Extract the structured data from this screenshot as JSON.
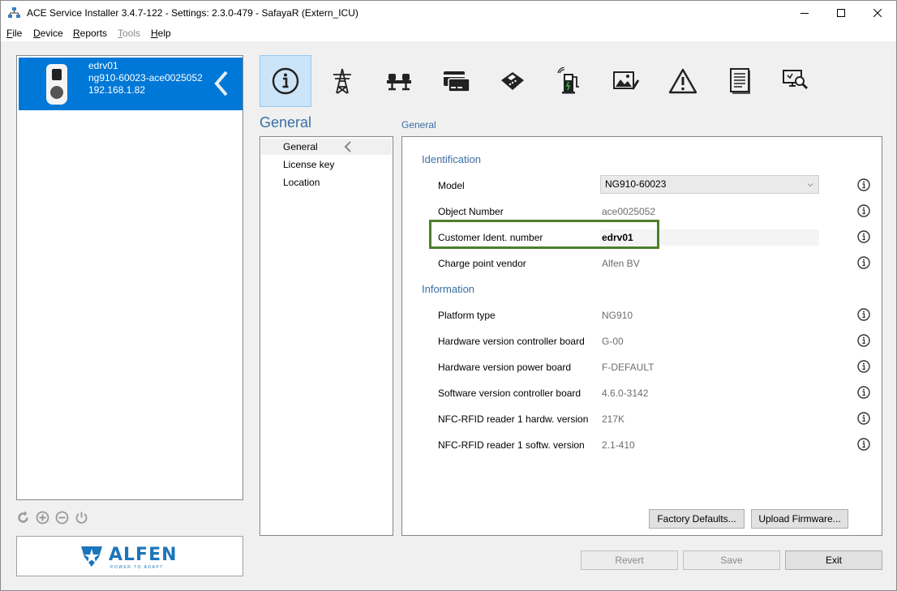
{
  "window": {
    "title": "ACE Service Installer 3.4.7-122 - Settings: 2.3.0-479 - SafayaR (Extern_ICU)"
  },
  "menu": {
    "items": [
      {
        "label": "File",
        "mnemonic": "F",
        "rest": "ile"
      },
      {
        "label": "Device",
        "mnemonic": "D",
        "rest": "evice"
      },
      {
        "label": "Reports",
        "mnemonic": "R",
        "rest": "eports"
      },
      {
        "label": "Tools",
        "mnemonic": "T",
        "rest": "ools",
        "enabled": false
      },
      {
        "label": "Help",
        "mnemonic": "H",
        "rest": "elp"
      }
    ]
  },
  "device": {
    "name": "edrv01",
    "id": "ng910-60023-ace0025052",
    "ip": "192.168.1.82"
  },
  "device_actions": [
    "refresh-icon",
    "add-icon",
    "remove-icon",
    "power-icon"
  ],
  "logo": {
    "text": "ALFEN",
    "tagline": "POWER TO ADAPT"
  },
  "toolbar": {
    "icons": [
      "info-icon",
      "power-tower-icon",
      "balance-icon",
      "card-icon",
      "payment-terminal-icon",
      "charging-station-icon",
      "image-icon",
      "warning-icon",
      "document-icon",
      "monitor-search-icon"
    ],
    "active": "info-icon"
  },
  "section": {
    "title": "General"
  },
  "nav": {
    "items": [
      "General",
      "License key",
      "Location"
    ],
    "selected": "General"
  },
  "content": {
    "title": "General",
    "identification": {
      "title": "Identification",
      "model_label": "Model",
      "model_value": "NG910-60023",
      "object_number_label": "Object Number",
      "object_number_value": "ace0025052",
      "customer_ident_label": "Customer Ident. number",
      "customer_ident_value": "edrv01",
      "vendor_label": "Charge point vendor",
      "vendor_value": "Alfen BV"
    },
    "information": {
      "title": "Information",
      "rows": [
        {
          "label": "Platform type",
          "value": "NG910"
        },
        {
          "label": "Hardware version controller board",
          "value": "G-00"
        },
        {
          "label": "Hardware version power board",
          "value": "F-DEFAULT"
        },
        {
          "label": "Software version controller board",
          "value": "4.6.0-3142"
        },
        {
          "label": "NFC-RFID reader 1 hardw. version",
          "value": "217K"
        },
        {
          "label": "NFC-RFID reader 1 softw. version",
          "value": "2.1-410"
        }
      ]
    }
  },
  "buttons": {
    "factory_defaults": "Factory Defaults...",
    "upload_firmware": "Upload Firmware...",
    "revert": "Revert",
    "save": "Save",
    "exit": "Exit"
  },
  "colors": {
    "selection": "#0078d7",
    "accent_text": "#3a6ea5",
    "highlight_border": "#4e7f2c",
    "brand": "#1b75bb"
  }
}
